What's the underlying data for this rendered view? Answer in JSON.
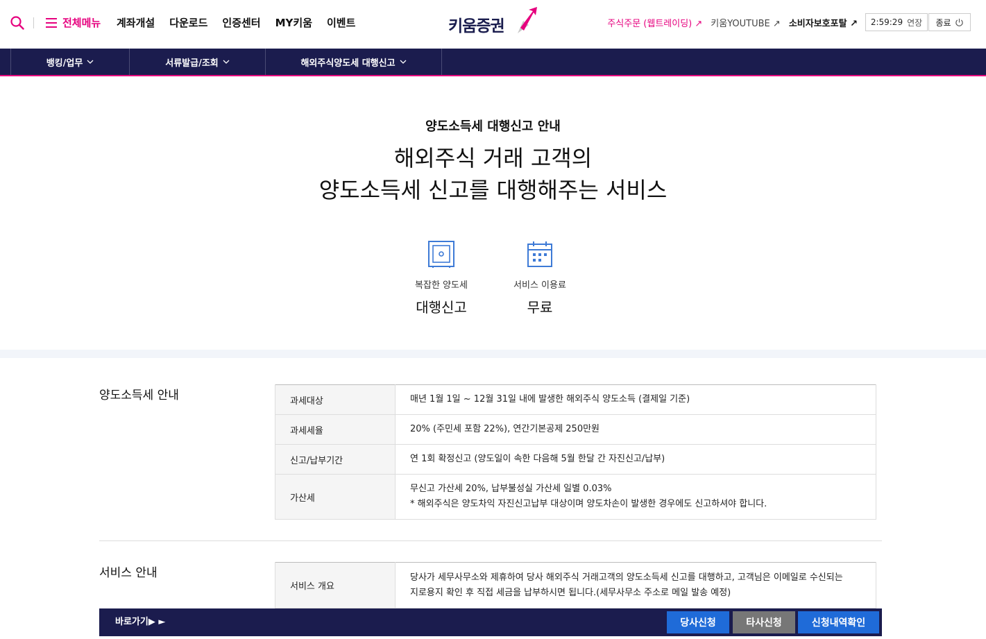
{
  "header": {
    "search_icon": "search-icon",
    "all_menu_label": "전체메뉴",
    "gnb": [
      "계좌개설",
      "다운로드",
      "인증센터",
      "MY키움",
      "이벤트"
    ],
    "logo_text": "키움증권",
    "util": [
      {
        "label": "주식주문 (웹트레이딩)",
        "style": "pink"
      },
      {
        "label": "키움YOUTUBE",
        "style": "gray"
      },
      {
        "label": "소비자보호포탈",
        "style": "bold"
      }
    ],
    "timer_value": "2:59:29",
    "timer_extend": "연장",
    "logout_label": "종료"
  },
  "nav": {
    "items": [
      "뱅킹/업무",
      "서류발급/조회",
      "해외주식양도세 대행신고"
    ]
  },
  "hero": {
    "subtitle": "양도소득세 대행신고 안내",
    "title_line1": "해외주식 거래 고객의",
    "title_line2": "양도소득세 신고를 대행해주는 서비스",
    "features": [
      {
        "icon": "safe-icon",
        "caption": "복잡한 양도세",
        "value": "대행신고"
      },
      {
        "icon": "calendar-icon",
        "caption": "서비스 이용료",
        "value": "무료"
      }
    ]
  },
  "tax_section": {
    "title": "양도소득세 안내",
    "rows": [
      {
        "label": "과세대상",
        "value": "매년 1월 1일 ~ 12월 31일 내에 발생한 해외주식 양도소득 (결제일 기준)"
      },
      {
        "label": "과세세율",
        "value": "20% (주민세 포함 22%), 연간기본공제 250만원"
      },
      {
        "label": "신고/납부기간",
        "value": "연 1회 확정신고 (양도일이 속한 다음해 5월 한달 간 자진신고/납부)"
      },
      {
        "label": "가산세",
        "value": "무신고 가산세 20%, 납부불성실 가산세 일별 0.03%",
        "note": "* 해외주식은 양도차익 자진신고납부 대상이며 양도차손이 발생한 경우에도 신고하셔야 합니다."
      }
    ]
  },
  "service_section": {
    "title": "서비스 안내",
    "rows": [
      {
        "label": "서비스 개요",
        "value_line1": "당사가 세무사무소와 제휴하여 당사 해외주식 거래고객의 양도소득세 신고를 대행하고, 고객님은 이메일로 수신되는",
        "value_line2": "지로용지 확인 후 직접 세금을 납부하시면 됩니다.(세무사무소 주소로 메일 발송 예정)"
      }
    ]
  },
  "bottom_bar": {
    "goto_label": "바로가기▶ ►",
    "buttons": [
      "당사신청",
      "타사신청",
      "신청내역확인"
    ]
  },
  "colors": {
    "brand_pink": "#e6007e",
    "navy": "#1b1c4e",
    "blue_button": "#1f6bd8",
    "gray_button": "#777777",
    "icon_blue": "#3d7ad6"
  }
}
